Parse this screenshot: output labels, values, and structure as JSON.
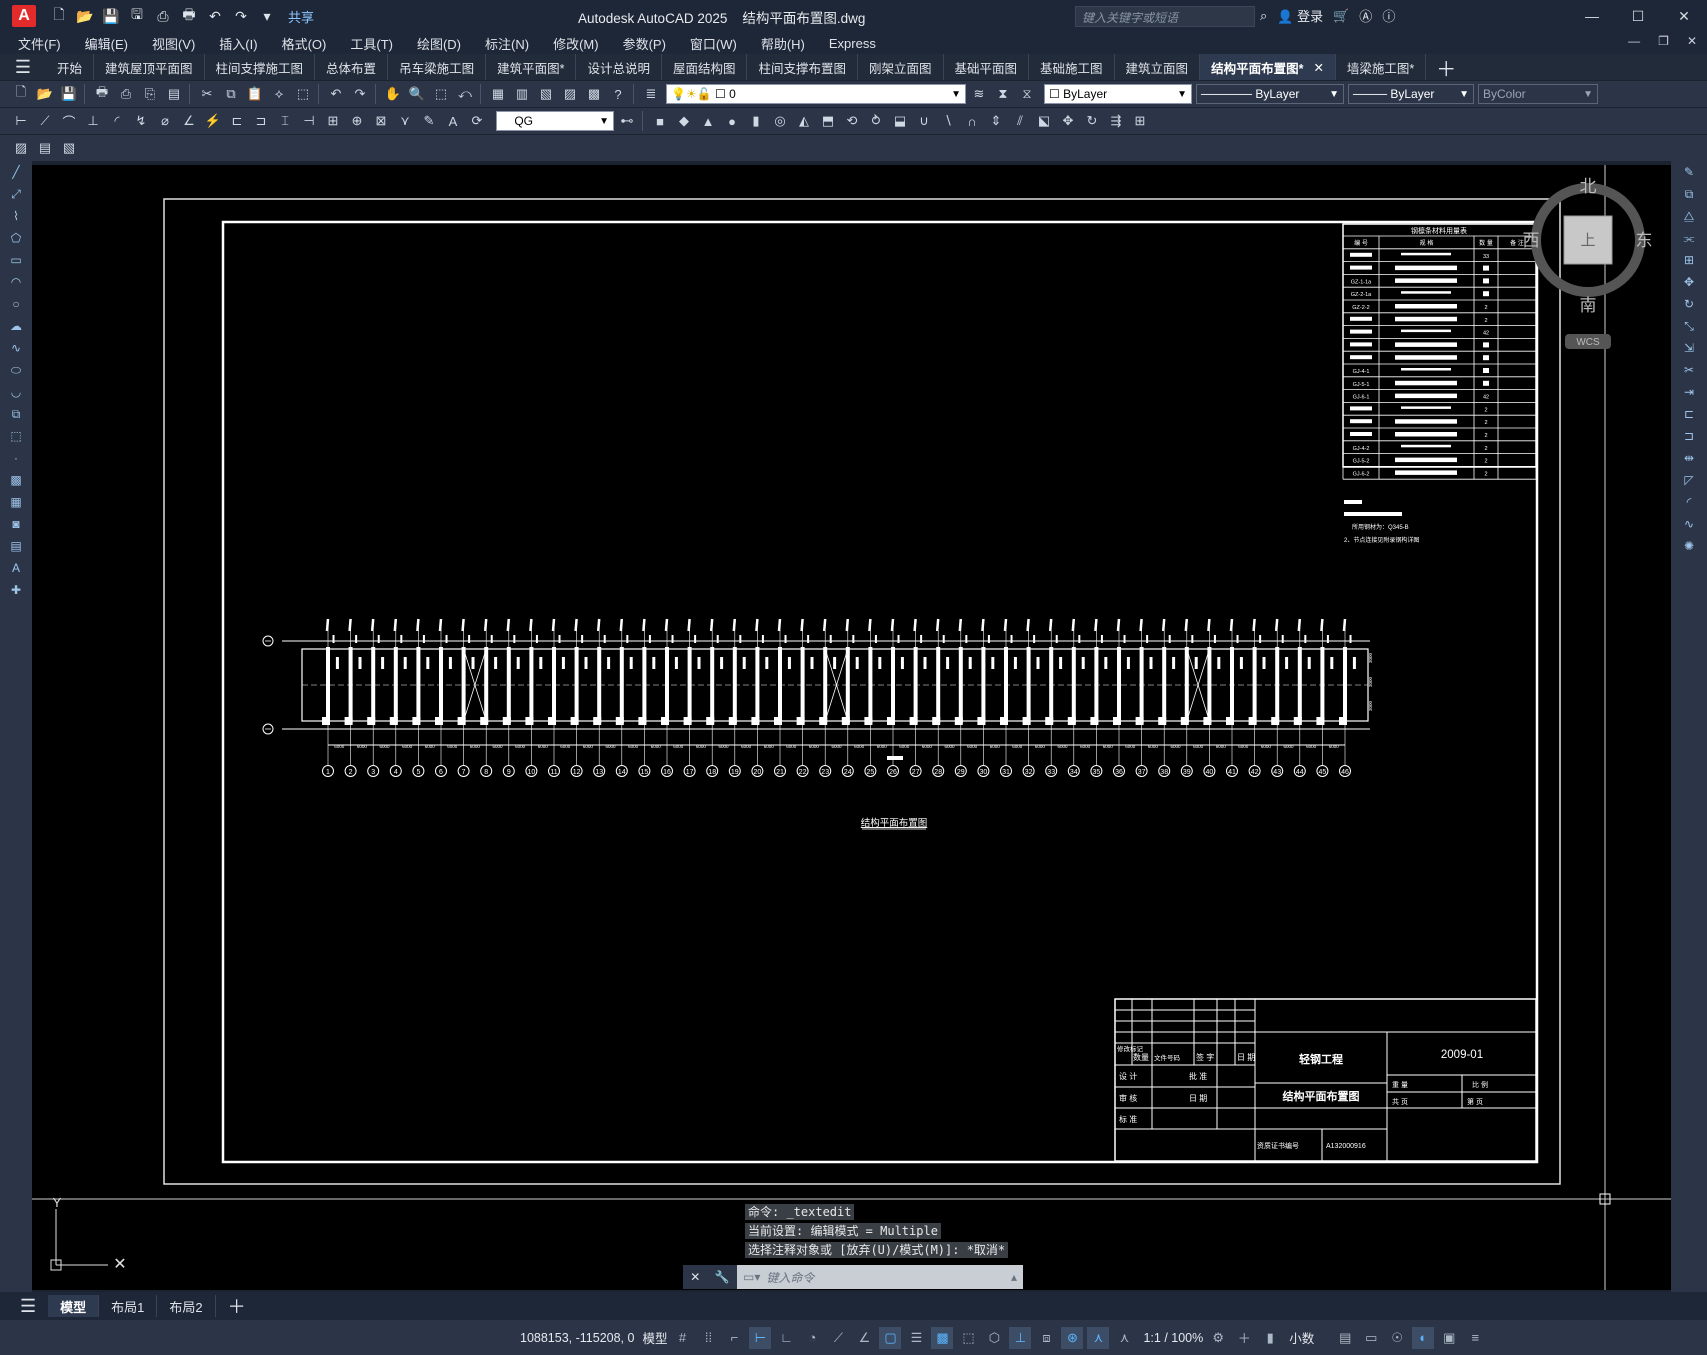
{
  "app": {
    "title": "Autodesk AutoCAD 2025",
    "file": "结构平面布置图.dwg",
    "share": "共享",
    "search_placeholder": "键入关键字或短语",
    "login": "登录",
    "logo": "A"
  },
  "menu": [
    "文件(F)",
    "编辑(E)",
    "视图(V)",
    "插入(I)",
    "格式(O)",
    "工具(T)",
    "绘图(D)",
    "标注(N)",
    "修改(M)",
    "参数(P)",
    "窗口(W)",
    "帮助(H)",
    "Express"
  ],
  "file_tabs": [
    "开始",
    "建筑屋顶平面图",
    "柱间支撑施工图",
    "总体布置",
    "吊车梁施工图",
    "建筑平面图*",
    "设计总说明",
    "屋面结构图",
    "柱间支撑布置图",
    "刚架立面图",
    "基础平面图",
    "基础施工图",
    "建筑立面图",
    "结构平面布置图*",
    "墙梁施工图*"
  ],
  "active_tab": "结构平面布置图*",
  "properties": {
    "layer": "0",
    "color": "ByLayer",
    "linetype": "ByLayer",
    "lineweight": "ByLayer",
    "plotstyle": "ByColor",
    "dimstyle": "QG"
  },
  "viewcube": {
    "north": "北",
    "south": "南",
    "east": "东",
    "west": "西",
    "top": "上",
    "wcs": "WCS"
  },
  "drawing": {
    "table_title": "钢檩条材料用量表",
    "table_headers": [
      "编 号",
      "规 格",
      "数 量",
      "备 注"
    ],
    "table_rows": [
      [
        "",
        "",
        "33",
        ""
      ],
      [
        "",
        "",
        "",
        ""
      ],
      [
        "GZ-1-1a",
        "",
        "",
        ""
      ],
      [
        "GZ-2-1a",
        "",
        "",
        ""
      ],
      [
        "GZ-2-2",
        "",
        "2",
        ""
      ],
      [
        "",
        "",
        "2",
        ""
      ],
      [
        "",
        "",
        "42",
        ""
      ],
      [
        "",
        "",
        "",
        ""
      ],
      [
        "",
        "",
        "",
        ""
      ],
      [
        "GJ-4-1",
        "",
        "",
        ""
      ],
      [
        "GJ-5-1",
        "",
        "",
        ""
      ],
      [
        "GJ-6-1",
        "",
        "42",
        ""
      ],
      [
        "",
        "",
        "2",
        ""
      ],
      [
        "",
        "",
        "2",
        ""
      ],
      [
        "",
        "",
        "2",
        ""
      ],
      [
        "GJ-4-2",
        "",
        "2",
        ""
      ],
      [
        "GJ-5-2",
        "",
        "2",
        ""
      ],
      [
        "GJ-6-2",
        "",
        "2",
        ""
      ]
    ],
    "note1": "所用钢材为：Q345-B",
    "note2": "2、节点连接见附录钢构详图",
    "plan_title": "结构平面布置图",
    "axes": [
      "1",
      "2",
      "3",
      "4",
      "5",
      "6",
      "7",
      "8",
      "9",
      "10",
      "11",
      "12",
      "13",
      "14",
      "15",
      "16",
      "17",
      "18",
      "19",
      "20",
      "21",
      "22",
      "23",
      "24",
      "25",
      "26",
      "27",
      "28",
      "29",
      "30",
      "31",
      "32",
      "33",
      "34",
      "35",
      "36",
      "37",
      "38",
      "39",
      "40",
      "41",
      "42",
      "43",
      "44",
      "45",
      "46"
    ],
    "tb": {
      "project": "轻钢工程",
      "drawing": "结构平面布置图",
      "date": "2009-01",
      "cert_label": "资质证书编号",
      "cert": "A132000916",
      "design": "设 计",
      "review": "审 核",
      "standard": "标 准",
      "approve": "批 准",
      "datel": "日 期",
      "mark": "修改标记",
      "qty": "数量",
      "docno": "文件号码",
      "sign": "签 字",
      "date2": "日 期",
      "scale": "比  例",
      "total": "共    页",
      "page": "第    页",
      "weight": "重  量"
    }
  },
  "command": {
    "line1": "命令: _textedit",
    "line2": "当前设置: 编辑模式 = Multiple",
    "line3": "选择注释对象或 [放弃(U)/模式(M)]: *取消*",
    "placeholder": "键入命令"
  },
  "layouts": [
    "模型",
    "布局1",
    "布局2"
  ],
  "status": {
    "coords": "1088153, -115208, 0",
    "space": "模型",
    "scale": "1:1 / 100%",
    "units": "小数"
  },
  "colors": {
    "canvas": "#000000",
    "chrome": "#2b3547",
    "accent": "#5bb6ff"
  }
}
